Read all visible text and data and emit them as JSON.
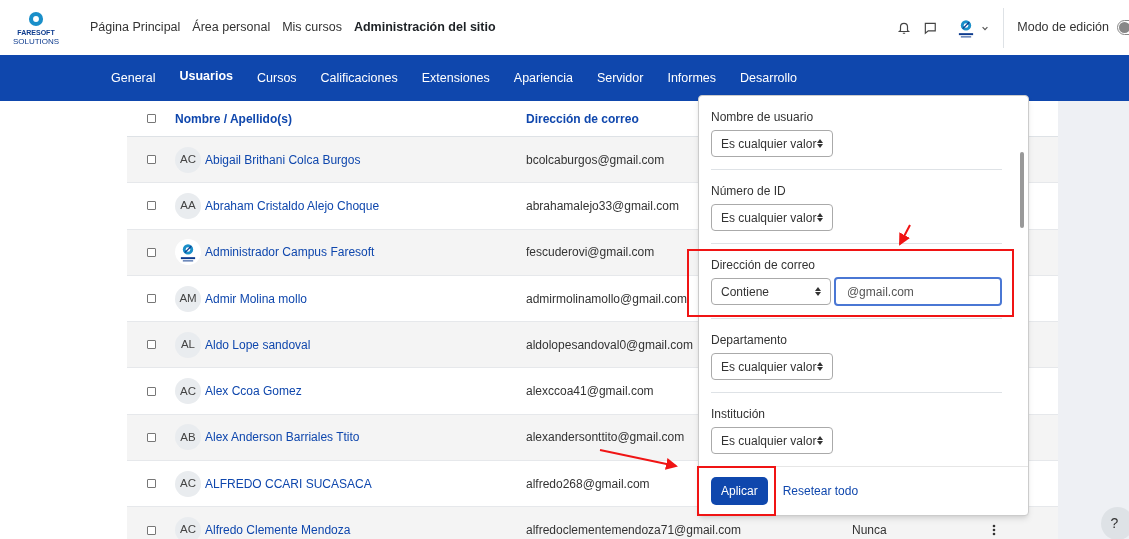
{
  "top_nav": {
    "brand": "FARESOFT",
    "brand_tagline": "SOLUTIONS",
    "links": [
      {
        "label": "Página Principal",
        "selected": false
      },
      {
        "label": "Área personal",
        "selected": false
      },
      {
        "label": "Mis cursos",
        "selected": false
      },
      {
        "label": "Administración del sitio",
        "selected": true
      }
    ],
    "edit_mode": {
      "label": "Modo de edición",
      "on": false
    }
  },
  "admin_tabs": [
    {
      "label": "General",
      "selected": false
    },
    {
      "label": "Usuarios",
      "selected": true
    },
    {
      "label": "Cursos",
      "selected": false
    },
    {
      "label": "Calificaciones",
      "selected": false
    },
    {
      "label": "Extensiones",
      "selected": false
    },
    {
      "label": "Apariencia",
      "selected": false
    },
    {
      "label": "Servidor",
      "selected": false
    },
    {
      "label": "Informes",
      "selected": false
    },
    {
      "label": "Desarrollo",
      "selected": false
    }
  ],
  "table": {
    "select_all_checked": false,
    "columns": [
      "Nombre / Apellido(s)",
      "Dirección de correo"
    ],
    "rows": [
      {
        "avatar": {
          "kind": "initials",
          "text": "AC"
        },
        "name": "Abigail Brithani Colca Burgos",
        "email": "bcolcaburgos@gmail.com",
        "checked": false
      },
      {
        "avatar": {
          "kind": "initials",
          "text": "AA"
        },
        "name": "Abraham Cristaldo Alejo Choque",
        "email": "abrahamalejo33@gmail.com",
        "checked": false
      },
      {
        "avatar": {
          "kind": "logo"
        },
        "name": "Administrador Campus Faresoft",
        "email": "fescuderovi@gmail.com",
        "checked": false
      },
      {
        "avatar": {
          "kind": "initials",
          "text": "AM"
        },
        "name": "Admir Molina mollo",
        "email": "admirmolinamollo@gmail.com",
        "checked": false
      },
      {
        "avatar": {
          "kind": "initials",
          "text": "AL"
        },
        "name": "Aldo Lope sandoval",
        "email": "aldolopesandoval0@gmail.com",
        "checked": false
      },
      {
        "avatar": {
          "kind": "initials",
          "text": "AC"
        },
        "name": "Alex Ccoa Gomez",
        "email": "alexccoa41@gmail.com",
        "checked": false
      },
      {
        "avatar": {
          "kind": "initials",
          "text": "AB"
        },
        "name": "Alex Anderson Barriales Ttito",
        "email": "alexandersonttito@gmail.com",
        "checked": false
      },
      {
        "avatar": {
          "kind": "initials",
          "text": "AC"
        },
        "name": "ALFREDO CCARI SUCASACA",
        "email": "alfredo268@gmail.com",
        "checked": false
      },
      {
        "avatar": {
          "kind": "initials",
          "text": "AC"
        },
        "name": "Alfredo Clemente Mendoza",
        "email": "alfredoclementemendoza71@gmail.com",
        "checked": false,
        "last_access": "Nunca"
      }
    ]
  },
  "filter_panel": {
    "filters": [
      {
        "label": "Nombre de usuario",
        "operator": "Es cualquier valor"
      },
      {
        "label": "Número de ID",
        "operator": "Es cualquier valor"
      },
      {
        "label": "Dirección de correo",
        "operator": "Contiene",
        "value": "@gmail.com",
        "focused": true
      },
      {
        "label": "Departamento",
        "operator": "Es cualquier valor"
      },
      {
        "label": "Institución",
        "operator": "Es cualquier valor"
      }
    ],
    "apply_button": "Aplicar",
    "reset_link": "Resetear todo"
  },
  "help_button": "?"
}
